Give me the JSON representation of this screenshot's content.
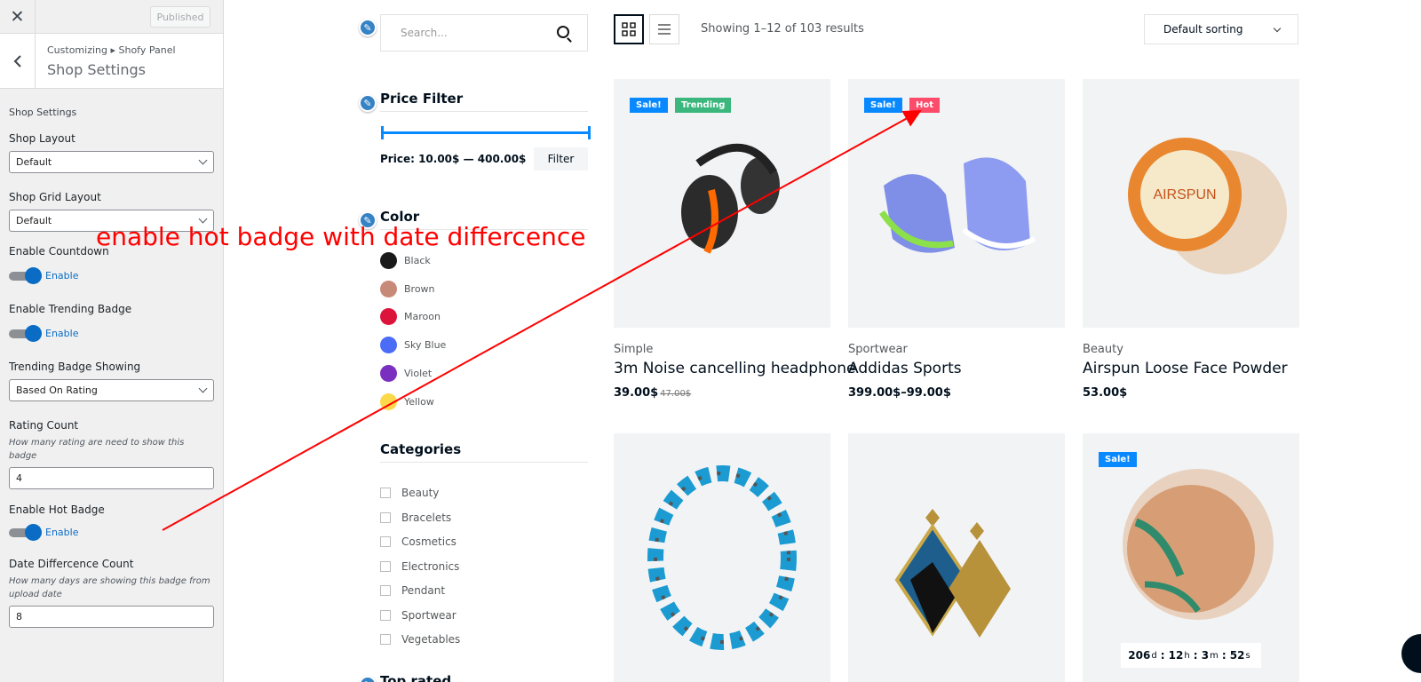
{
  "customizer": {
    "published_label": "Published",
    "breadcrumb": "Customizing ▸ Shofy Panel",
    "title": "Shop Settings",
    "section_label": "Shop Settings",
    "shop_layout": {
      "label": "Shop Layout",
      "value": "Default"
    },
    "shop_grid_layout": {
      "label": "Shop Grid Layout",
      "value": "Default"
    },
    "enable_countdown": {
      "label": "Enable Countdown",
      "toggle": "Enable"
    },
    "enable_trending": {
      "label": "Enable Trending Badge",
      "toggle": "Enable"
    },
    "trending_showing": {
      "label": "Trending Badge Showing",
      "value": "Based On Rating"
    },
    "rating_count": {
      "label": "Rating Count",
      "desc": "How many rating are need to show this badge",
      "value": "4"
    },
    "enable_hot": {
      "label": "Enable Hot Badge",
      "toggle": "Enable"
    },
    "date_diff": {
      "label": "Date Differcence Count",
      "desc": "How many days are showing this badge from upload date",
      "value": "8"
    }
  },
  "annotation": "enable hot badge with date differcence",
  "shop": {
    "search_placeholder": "Search...",
    "price_filter": {
      "title": "Price Filter",
      "label": "Price:",
      "range": "10.00$ — 400.00$",
      "button": "Filter"
    },
    "color": {
      "title": "Color",
      "items": [
        {
          "name": "Black",
          "hex": "#1a1a1a"
        },
        {
          "name": "Brown",
          "hex": "#c88a78"
        },
        {
          "name": "Maroon",
          "hex": "#dc143c"
        },
        {
          "name": "Sky Blue",
          "hex": "#4a6cf7"
        },
        {
          "name": "Violet",
          "hex": "#7b2fbf"
        },
        {
          "name": "Yellow",
          "hex": "#fbd94a"
        }
      ]
    },
    "categories": {
      "title": "Categories",
      "items": [
        "Beauty",
        "Bracelets",
        "Cosmetics",
        "Electronics",
        "Pendant",
        "Sportwear",
        "Vegetables"
      ]
    },
    "top_rated_title": "Top rated",
    "results_text": "Showing 1–12 of 103 results",
    "sort_value": "Default sorting",
    "products": [
      {
        "badges": [
          "Sale!",
          "Trending"
        ],
        "category": "Simple",
        "name": "3m Noise cancelling headphone",
        "price": "39.00$",
        "old_price": "47.00$"
      },
      {
        "badges": [
          "Sale!",
          "Hot"
        ],
        "category": "Sportwear",
        "name": "Addidas Sports",
        "price": "399.00$–99.00$",
        "old_price": ""
      },
      {
        "badges": [],
        "category": "Beauty",
        "name": "Airspun Loose Face Powder",
        "price": "53.00$",
        "old_price": ""
      },
      {
        "badges": [],
        "category": "",
        "name": "",
        "price": "",
        "old_price": ""
      },
      {
        "badges": [],
        "category": "",
        "name": "",
        "price": "",
        "old_price": ""
      },
      {
        "badges": [
          "Sale!"
        ],
        "category": "",
        "name": "",
        "price": "",
        "old_price": ""
      }
    ],
    "countdown": {
      "d": "206",
      "d_unit": "d",
      "h": "12",
      "h_unit": "h",
      "m": "3",
      "m_unit": "m",
      "s": "52",
      "s_unit": "s"
    }
  }
}
